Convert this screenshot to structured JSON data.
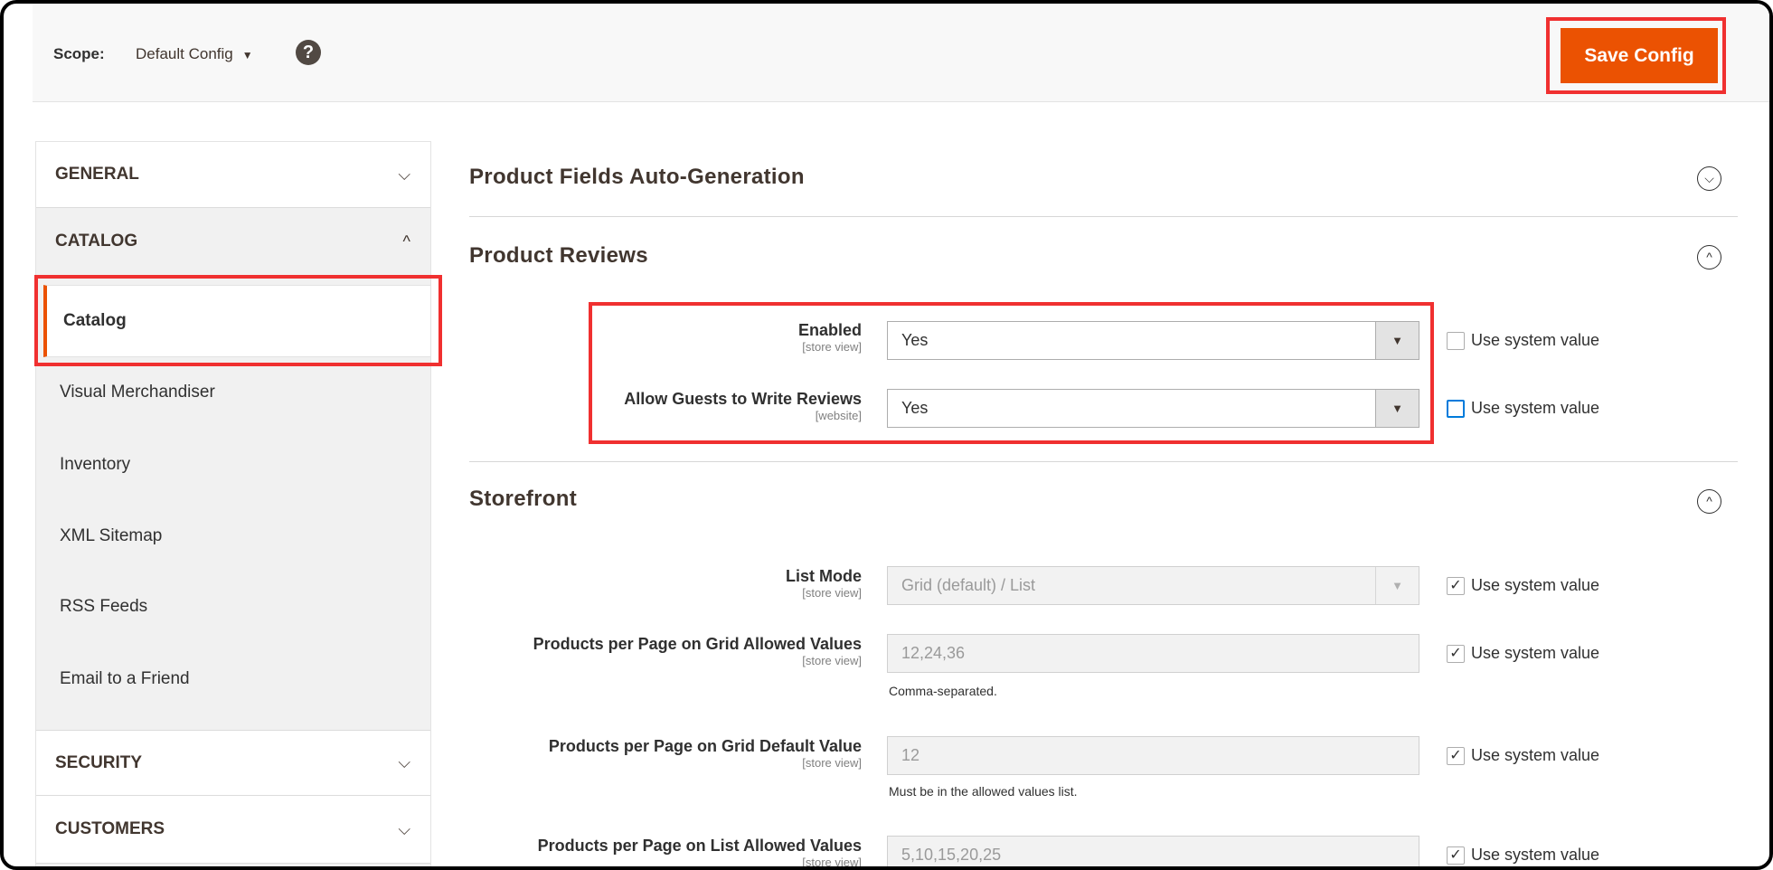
{
  "header": {
    "scope_label": "Scope:",
    "scope_value": "Default Config",
    "help_icon": "question-circle-icon",
    "save_label": "Save Config"
  },
  "colors": {
    "accent": "#eb5202",
    "highlight": "#f03030",
    "focus": "#007bdb"
  },
  "sidebar": {
    "general": "GENERAL",
    "catalog": "CATALOG",
    "items": [
      {
        "label": "Catalog",
        "active": true
      },
      {
        "label": "Visual Merchandiser"
      },
      {
        "label": "Inventory"
      },
      {
        "label": "XML Sitemap"
      },
      {
        "label": "RSS Feeds"
      },
      {
        "label": "Email to a Friend"
      }
    ],
    "security": "SECURITY",
    "customers": "CUSTOMERS"
  },
  "main": {
    "sections": {
      "auto_gen": "Product Fields Auto-Generation",
      "reviews": "Product Reviews",
      "storefront": "Storefront"
    },
    "use_system": "Use system value",
    "reviews_fields": [
      {
        "label": "Enabled",
        "scope": "[store view]",
        "value": "Yes",
        "use_system": false
      },
      {
        "label": "Allow Guests to Write Reviews",
        "scope": "[website]",
        "value": "Yes",
        "use_system": false
      }
    ],
    "storefront_fields": [
      {
        "label": "List Mode",
        "scope": "[store view]",
        "value": "Grid (default) / List",
        "use_system": true
      },
      {
        "label": "Products per Page on Grid Allowed Values",
        "scope": "[store view]",
        "value": "12,24,36",
        "note": "Comma-separated.",
        "use_system": true
      },
      {
        "label": "Products per Page on Grid Default Value",
        "scope": "[store view]",
        "value": "12",
        "note": "Must be in the allowed values list.",
        "use_system": true
      },
      {
        "label": "Products per Page on List Allowed Values",
        "scope": "[store view]",
        "value": "5,10,15,20,25",
        "use_system": true
      }
    ]
  }
}
